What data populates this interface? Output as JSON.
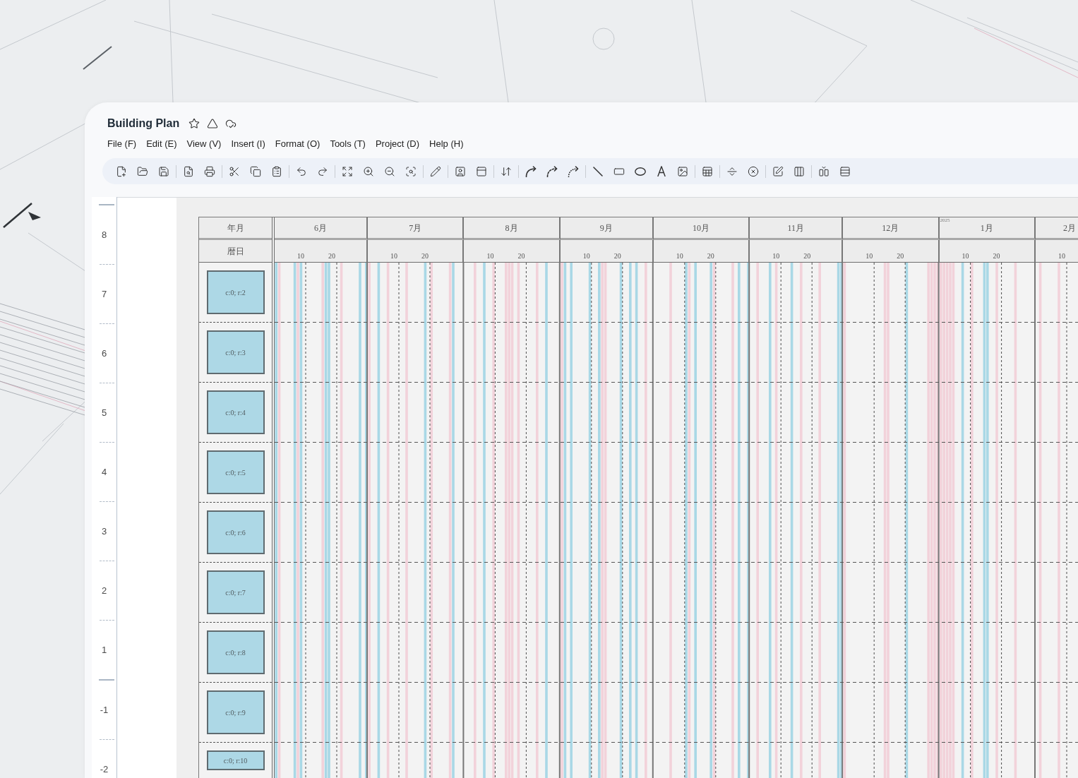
{
  "window": {
    "title": "Building Plan"
  },
  "menu": [
    "File (F)",
    "Edit (E)",
    "View (V)",
    "Insert (I)",
    "Format (O)",
    "Tools (T)",
    "Project (D)",
    "Help (H)"
  ],
  "ruler": {
    "marks": [
      {
        "label": "8",
        "major": true
      },
      {
        "label": "7",
        "major": false
      },
      {
        "label": "6",
        "major": false
      },
      {
        "label": "5",
        "major": false
      },
      {
        "label": "4",
        "major": false
      },
      {
        "label": "3",
        "major": false
      },
      {
        "label": "2",
        "major": false
      },
      {
        "label": "1",
        "major": false
      },
      {
        "label": "-1",
        "major": true
      },
      {
        "label": "-2",
        "major": false
      }
    ]
  },
  "table": {
    "header": [
      "年月",
      "暦日"
    ],
    "months": [
      {
        "label": "6月",
        "ticks": [
          "10",
          "20"
        ]
      },
      {
        "label": "7月",
        "ticks": [
          "10",
          "20"
        ]
      },
      {
        "label": "8月",
        "ticks": [
          "10",
          "20"
        ]
      },
      {
        "label": "9月",
        "ticks": [
          "10",
          "20"
        ]
      },
      {
        "label": "10月",
        "ticks": [
          "10",
          "20"
        ]
      },
      {
        "label": "11月",
        "ticks": [
          "10",
          "20"
        ]
      },
      {
        "label": "12月",
        "ticks": [
          "10",
          "20"
        ]
      },
      {
        "label": "1月",
        "year_mark": "2025",
        "ticks": [
          "10",
          "20"
        ]
      },
      {
        "label": "2月",
        "ticks": [
          "10"
        ]
      }
    ],
    "rows": [
      "c:0; r:2",
      "c:0; r:3",
      "c:0; r:4",
      "c:0; r:5",
      "c:0; r:6",
      "c:0; r:7",
      "c:0; r:8",
      "c:0; r:9",
      "c:0; r:10"
    ]
  }
}
